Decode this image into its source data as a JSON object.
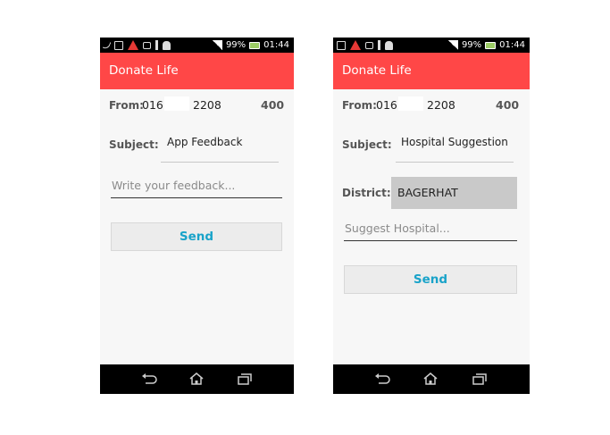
{
  "phones": [
    {
      "status": {
        "battery": "99%",
        "time": "01:44"
      },
      "app_title": "Donate Life",
      "from_label": "From:",
      "from_prefix": "016",
      "from_suffix": "2208",
      "char_count": "400",
      "subject_label": "Subject:",
      "subject_value": "App Feedback",
      "feedback_placeholder": "Write your feedback...",
      "send_label": "Send"
    },
    {
      "status": {
        "battery": "99%",
        "time": "01:44"
      },
      "app_title": "Donate Life",
      "from_label": "From:",
      "from_prefix": "016",
      "from_suffix": "2208",
      "char_count": "400",
      "subject_label": "Subject:",
      "subject_value": "Hospital Suggestion",
      "district_label": "District:",
      "district_value": "BAGERHAT",
      "hospital_placeholder": "Suggest Hospital...",
      "send_label": "Send"
    }
  ],
  "icons": {
    "status_left": [
      "call-icon",
      "image-icon",
      "warning-icon",
      "chat-icon",
      "usb-icon",
      "android-icon"
    ],
    "status_right": [
      "signal-icon",
      "battery-icon"
    ],
    "nav": [
      "back-icon",
      "home-icon",
      "recent-apps-icon"
    ]
  },
  "colors": {
    "appbar": "#ff4747",
    "accent": "#19a3c9",
    "district_bg": "#c9c9c9"
  }
}
